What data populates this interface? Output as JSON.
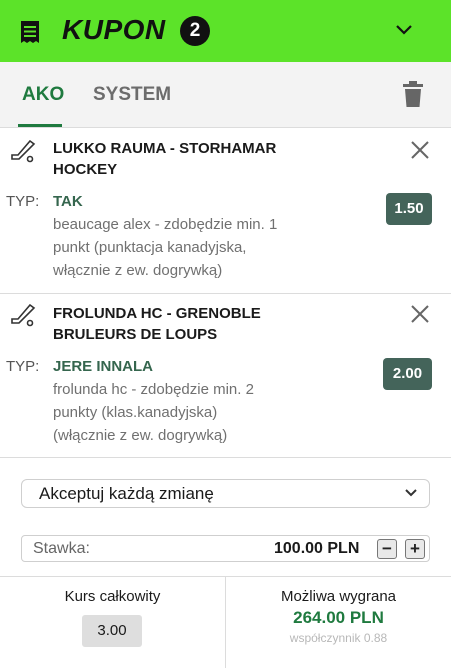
{
  "header": {
    "title": "KUPON",
    "count": "2",
    "accent": "#5ce329"
  },
  "tabs": [
    {
      "label": "AKO",
      "active": true
    },
    {
      "label": "SYSTEM",
      "active": false
    }
  ],
  "bets": [
    {
      "match_line1": "LUKKO RAUMA - STORHAMAR",
      "match_line2": "HOCKEY",
      "typ_label": "TYP:",
      "pick": "TAK",
      "desc_line1": "beaucage alex - zdobędzie min. 1",
      "desc_line2": "punkt (punktacja kanadyjska,",
      "desc_line3": "włącznie z ew. dogrywką)",
      "odds": "1.50",
      "icon": "hockey-stick-icon"
    },
    {
      "match_line1": "FROLUNDA HC - GRENOBLE",
      "match_line2": "BRULEURS DE LOUPS",
      "typ_label": "TYP:",
      "pick": "JERE INNALA",
      "desc_line1": "frolunda hc - zdobędzie min. 2",
      "desc_line2": "punkty (klas.kanadyjska)",
      "desc_line3": "(włącznie z ew. dogrywką)",
      "odds": "2.00",
      "icon": "hockey-stick-icon"
    }
  ],
  "accept_select": {
    "value": "Akceptuj każdą zmianę"
  },
  "stake": {
    "label": "Stawka:",
    "amount": "100.00 PLN",
    "minus": "−",
    "plus": "+"
  },
  "summary": {
    "kurs_label": "Kurs całkowity",
    "kurs_value": "3.00",
    "win_label": "Możliwa wygrana",
    "win_value": "264.00 PLN",
    "coef": "współczynnik 0.88"
  },
  "colors": {
    "primary_green": "#1f7a3f",
    "odds_bg": "#44645a"
  }
}
